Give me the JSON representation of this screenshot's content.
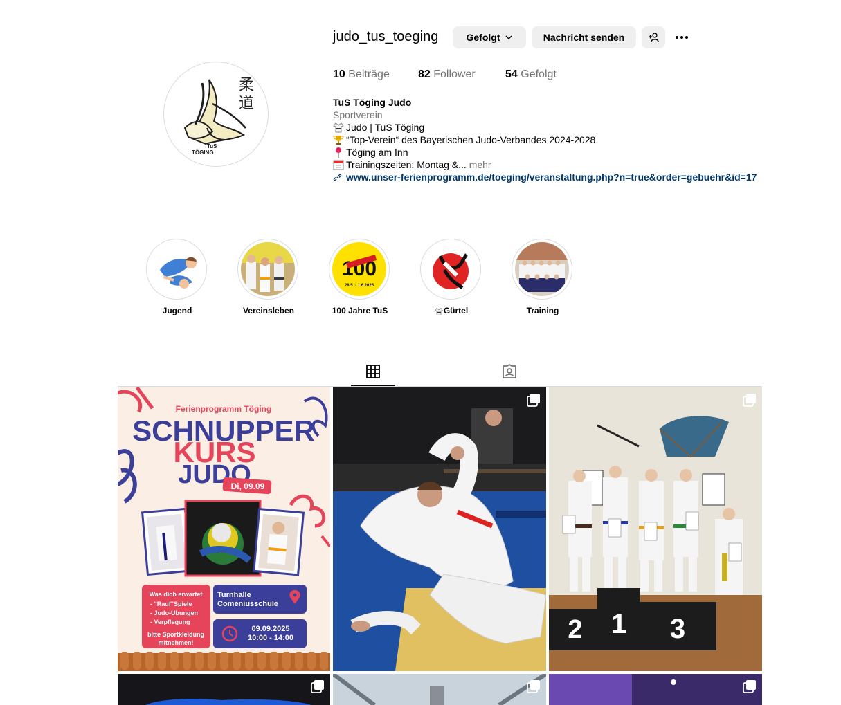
{
  "profile": {
    "username": "judo_tus_toeging",
    "buttons": {
      "following": "Gefolgt",
      "message": "Nachricht senden"
    },
    "stats": [
      {
        "count": "10",
        "label": "Beiträge"
      },
      {
        "count": "82",
        "label": "Follower"
      },
      {
        "count": "54",
        "label": "Gefolgt"
      }
    ],
    "bio": {
      "name": "TuS Töging Judo",
      "category": "Sportverein",
      "lines": [
        "Judo | TuS Töging",
        "“Top-Verein“ des Bayerischen Judo-Verbandes 2024-2028",
        "Töging am Inn",
        "Trainingszeiten: Montag &..."
      ],
      "more": "mehr",
      "link": "www.unser-ferienprogramm.de/toeging/veranstaltung.php?n=true&order=gebuehr&id=17"
    },
    "avatar_text": {
      "kanji_1": "柔",
      "kanji_2": "道",
      "club_1": "TuS",
      "club_2": "TÖGING"
    }
  },
  "highlights": [
    {
      "label": "Jugend"
    },
    {
      "label": "Vereinsleben"
    },
    {
      "label": "100 Jahre TuS"
    },
    {
      "label": "Gürtel"
    },
    {
      "label": "Training"
    }
  ],
  "highlight_100": {
    "big": "100",
    "dates": "28.5. - 1.6.2025"
  },
  "posts": {
    "schnupper": {
      "header": "Ferienprogramm Töging",
      "title_1": "SCHNUPPER",
      "title_2": "KURS",
      "title_3": "JUDO",
      "date_tag": "Di, 09.09",
      "info_lines": [
        "Was dich erwartet",
        "- \"Rauf\"Spiele",
        "- Judo-Übungen",
        "- Verpflegung",
        "bitte Sportkleidung",
        "mitnehmen!"
      ],
      "location": [
        "Turnhalle",
        "Comeniusschule"
      ],
      "time": [
        "09.09.2025",
        "10:00 - 14:00"
      ]
    },
    "podium": {
      "places": [
        "2",
        "1",
        "3"
      ]
    }
  },
  "colors": {
    "button_bg": "#efefef",
    "link": "#00376b",
    "muted": "#737373",
    "border": "#dbdbdb",
    "flyer_bg": "#fbeee4",
    "flyer_blue": "#3b3f9a",
    "flyer_red": "#e5445a"
  },
  "icons": [
    "chevron-down-icon",
    "add-person-icon",
    "more-options-icon",
    "grid-icon",
    "tagged-icon",
    "link-icon",
    "carousel-icon"
  ]
}
